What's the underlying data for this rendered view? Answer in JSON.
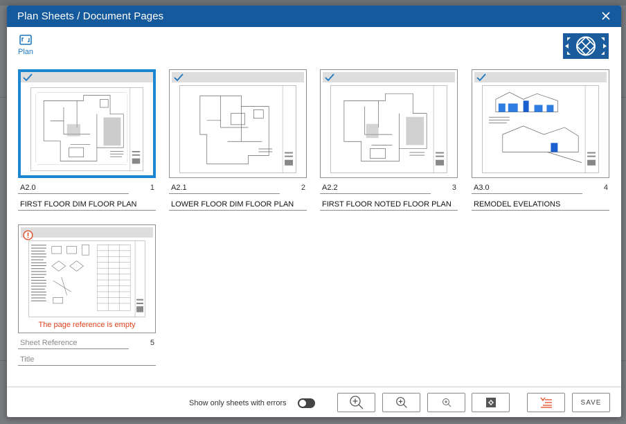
{
  "modal": {
    "title": "Plan Sheets / Document Pages"
  },
  "tabs": {
    "plan_label": "Plan"
  },
  "sheets": [
    {
      "ref": "A2.0",
      "page": "1",
      "title": "FIRST FLOOR DIM FLOOR PLAN",
      "selected": true,
      "status": "checked"
    },
    {
      "ref": "A2.1",
      "page": "2",
      "title": "LOWER FLOOR DIM FLOOR PLAN",
      "selected": false,
      "status": "checked"
    },
    {
      "ref": "A2.2",
      "page": "3",
      "title": "FIRST FLOOR NOTED FLOOR PLAN",
      "selected": false,
      "status": "checked"
    },
    {
      "ref": "A3.0",
      "page": "4",
      "title": "REMODEL EVELATIONS",
      "selected": false,
      "status": "checked"
    },
    {
      "ref_placeholder": "Sheet Reference",
      "page": "5",
      "title_placeholder": "Title",
      "selected": false,
      "status": "error",
      "error_message": "The page reference is empty"
    }
  ],
  "footer": {
    "toggle_label": "Show only sheets with errors",
    "toggle_on": false,
    "save_label": "SAVE"
  },
  "colors": {
    "header": "#155a9c",
    "accent": "#1a86d0",
    "error": "#e0431e",
    "check": "#1b76c0"
  },
  "icons": {
    "close": "close-icon",
    "plan": "plan-sheet-icon",
    "check": "checkmark-icon",
    "error": "error-icon",
    "zoom_in_large": "zoom-in-large-icon",
    "zoom_in_medium": "zoom-in-medium-icon",
    "zoom_in_small": "zoom-in-small-icon",
    "fit": "fit-to-screen-icon",
    "sort": "sort-list-icon"
  }
}
